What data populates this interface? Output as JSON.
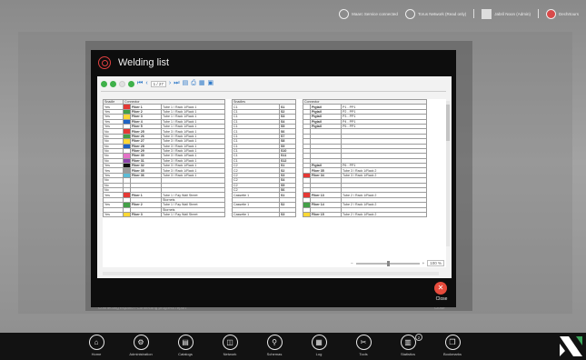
{
  "topbar": {
    "status1": "Maarc Service connected",
    "status2": "Torus Network (Read only)",
    "user": "Jabril Noon (Admin)",
    "user2": "Dechrtours"
  },
  "modal": {
    "title": "Welding list",
    "toolbar": {
      "page": "1 / 27"
    },
    "zoom": "100 %",
    "close_label": "Close",
    "close_glyph": "✕"
  },
  "report": {
    "headers": [
      "Snadle",
      "Connector",
      "",
      "",
      "Snadles",
      "",
      "Connector",
      "",
      ""
    ],
    "rows": [
      {
        "c1": "Yes",
        "color": "#e53935",
        "f1": "Fiber 1",
        "f2": "Tube 1 / Rack 1/Rack 1",
        "s1": "C1",
        "s2": "S1",
        "cx": "",
        "p1": "Pigtail",
        "p2": "P1 - PP1"
      },
      {
        "c1": "Yes",
        "color": "#43a047",
        "f1": "Fiber 2",
        "f2": "Tube 1 / Rack 1/Rack 1",
        "s1": "C1",
        "s2": "S2",
        "cx": "",
        "p1": "Pigtail",
        "p2": "P2 - PP1"
      },
      {
        "c1": "Yes",
        "color": "#fdd835",
        "f1": "Fiber 3",
        "f2": "Tube 1 / Rack 1/Rack 1",
        "s1": "C1",
        "s2": "S3",
        "cx": "",
        "p1": "Pigtail",
        "p2": "P3 - PP1"
      },
      {
        "c1": "Yes",
        "color": "#1e63c4",
        "f1": "Fiber 4",
        "f2": "Tube 1 / Rack 1/Rack 1",
        "s1": "C1",
        "s2": "S4",
        "cx": "",
        "p1": "Pigtail",
        "p2": "P4 - PP1"
      },
      {
        "c1": "Yes",
        "color": "#ffffff",
        "f1": "Fiber 5",
        "f2": "Tube 1 / Rack 1/Rack 1",
        "s1": "C1",
        "s2": "S5",
        "cx": "",
        "p1": "Pigtail",
        "p2": "P5 - PP1"
      },
      {
        "c1": "No",
        "color": "#e53935",
        "f1": "Fiber 25",
        "f2": "Tube 3 / Rack 1/Rack 1",
        "s1": "C1",
        "s2": "S6",
        "cx": "",
        "p1": "",
        "p2": ""
      },
      {
        "c1": "No",
        "color": "#43a047",
        "f1": "Fiber 26",
        "f2": "Tube 3 / Rack 1/Rack 1",
        "s1": "C1",
        "s2": "S7",
        "cx": "",
        "p1": "",
        "p2": ""
      },
      {
        "c1": "No",
        "color": "#fdd835",
        "f1": "Fiber 27",
        "f2": "Tube 3 / Rack 1/Rack 1",
        "s1": "C1",
        "s2": "S8",
        "cx": "",
        "p1": "",
        "p2": ""
      },
      {
        "c1": "No",
        "color": "#1e63c4",
        "f1": "Fiber 28",
        "f2": "Tube 3 / Rack 1/Rack 1",
        "s1": "C1",
        "s2": "S9",
        "cx": "",
        "p1": "",
        "p2": ""
      },
      {
        "c1": "No",
        "color": "#ffffff",
        "f1": "Fiber 29",
        "f2": "Tube 3 / Rack 1/Rack 1",
        "s1": "C1",
        "s2": "S10",
        "cx": "",
        "p1": "",
        "p2": ""
      },
      {
        "c1": "No",
        "color": "#e573c8",
        "f1": "Fiber 30",
        "f2": "Tube 3 / Rack 1/Rack 1",
        "s1": "C1",
        "s2": "S11",
        "cx": "",
        "p1": "",
        "p2": ""
      },
      {
        "c1": "No",
        "color": "#8e44ad",
        "f1": "Fiber 31",
        "f2": "Tube 3 / Rack 1/Rack 1",
        "s1": "C1",
        "s2": "S12",
        "cx": "",
        "p1": "",
        "p2": ""
      },
      {
        "c1": "Yes",
        "color": "#111111",
        "f1": "Fiber 32",
        "f2": "Tube 3 / Rack 1/Rack 1",
        "s1": "C2",
        "s2": "S1",
        "cx": "",
        "p1": "Pigtail",
        "p2": "P6 - PP1"
      },
      {
        "c1": "Yes",
        "color": "#9a9a9a",
        "f1": "Fiber 35",
        "f2": "Tube 3 / Rack 1/Rack 1",
        "s1": "C2",
        "s2": "S2",
        "cx": "",
        "p1": "Fiber 35",
        "p2": "Tube 3 / Rack 1/Rack 2"
      },
      {
        "c1": "Yes",
        "color": "#5bbcd6",
        "f1": "Fiber 36",
        "f2": "Tube 3 / Rack 1/Rack 1",
        "s1": "C2",
        "s2": "S3",
        "cx": "#e53935",
        "p1": "Fiber 34",
        "p2": "Tube 3 / Rack 1/Rack 2"
      },
      {
        "c1": "No",
        "color": "",
        "f1": "",
        "f2": "",
        "s1": "C2",
        "s2": "S4",
        "cx": "",
        "p1": "",
        "p2": ""
      },
      {
        "c1": "No",
        "color": "",
        "f1": "",
        "f2": "",
        "s1": "C2",
        "s2": "S5",
        "cx": "",
        "p1": "",
        "p2": ""
      },
      {
        "c1": "No",
        "color": "",
        "f1": "",
        "f2": "",
        "s1": "C2",
        "s2": "S6",
        "cx": "",
        "p1": "",
        "p2": ""
      },
      {
        "c1": "Yes",
        "color": "#e53935",
        "f1": "Fiber 1",
        "f2": "Tube 1 / Fay Wall Street",
        "s1": "Cassette 1",
        "s2": "S1",
        "cx": "#e53935",
        "p1": "Fiber 13",
        "p2": "Tube 2 / Rack 1/Rack 2"
      },
      {
        "c1": "",
        "color": "",
        "f1": "",
        "f2": "Stornets",
        "s1": "",
        "s2": "",
        "cx": "",
        "p1": "",
        "p2": ""
      },
      {
        "c1": "Yes",
        "color": "#43a047",
        "f1": "Fiber 2",
        "f2": "Tube 1 / Fay Wall Street",
        "s1": "Cassette 1",
        "s2": "S2",
        "cx": "#43a047",
        "p1": "Fiber 14",
        "p2": "Tube 2 / Rack 1/Rack 2"
      },
      {
        "c1": "",
        "color": "",
        "f1": "",
        "f2": "Stornets",
        "s1": "",
        "s2": "",
        "cx": "",
        "p1": "",
        "p2": ""
      },
      {
        "c1": "Yes",
        "color": "#fdd835",
        "f1": "Fiber 3",
        "f2": "Tube 1 / Fay Wall Street",
        "s1": "Cassette 1",
        "s2": "S3",
        "cx": "#fdd835",
        "p1": "Fiber 15",
        "p2": "Tube 2 / Rack 1/Rack 2"
      }
    ]
  },
  "background": {
    "footer_left": "Connecting expand / Connecting progress report",
    "footer_right": "Close"
  },
  "nav": {
    "items": [
      {
        "label": "Home",
        "glyph": "⌂"
      },
      {
        "label": "Administration",
        "glyph": "⚙"
      },
      {
        "label": "Catalogs",
        "glyph": "▤"
      },
      {
        "label": "Network",
        "glyph": "◫"
      },
      {
        "label": "Schemas",
        "glyph": "⚲"
      },
      {
        "label": "Log",
        "glyph": "▦"
      },
      {
        "label": "Tools",
        "glyph": "✂"
      },
      {
        "label": "Statistics",
        "glyph": "▥"
      },
      {
        "label": "Bookmarks",
        "glyph": "❒"
      }
    ],
    "badge": "2"
  }
}
